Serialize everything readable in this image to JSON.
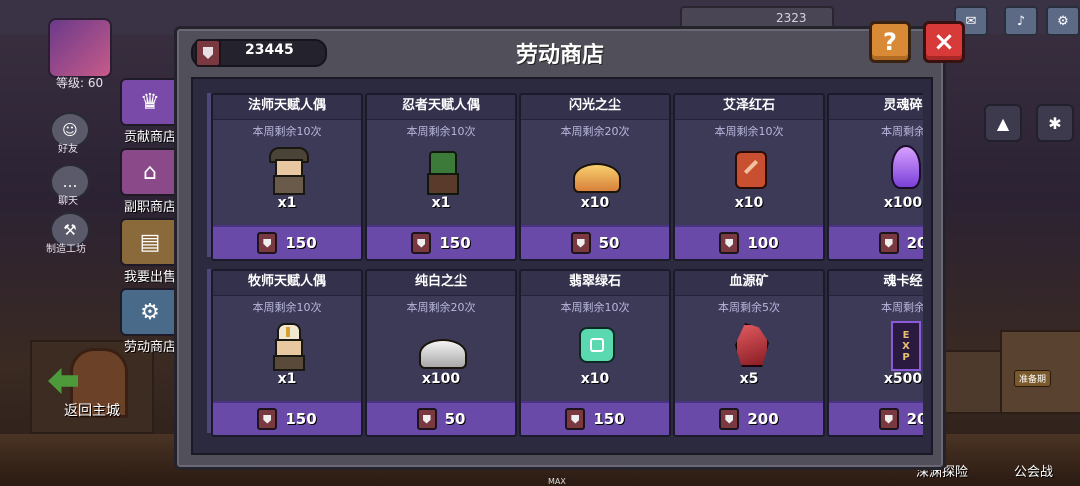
{
  "currency": {
    "amount": "23445"
  },
  "modal": {
    "title": "劳动商店",
    "help_label": "?",
    "close_label": "×"
  },
  "player": {
    "level": "等级: 60"
  },
  "hud": {
    "value": "2323"
  },
  "sidebar": {
    "small": [
      {
        "label": "好友",
        "icon": "friend-icon"
      },
      {
        "label": "聊天",
        "icon": "chat-icon"
      },
      {
        "label": "制造工坊",
        "icon": "workshop-icon"
      }
    ],
    "items": [
      {
        "label": "贡献商店",
        "icon": "contribution-shop-icon",
        "color": "#7a4aa8"
      },
      {
        "label": "副职商店",
        "icon": "side-job-shop-icon",
        "color": "#8a4a8a"
      },
      {
        "label": "我要出售",
        "icon": "sell-icon",
        "color": "#8a6a3a"
      },
      {
        "label": "劳动商店",
        "icon": "labor-shop-icon",
        "color": "#4a6a8a"
      }
    ],
    "back_label": "返回主城"
  },
  "bottom": {
    "left_label": "深渊探险",
    "right_label": "公会战",
    "badge": "准备期",
    "max": "MAX"
  },
  "shop": {
    "row1": [
      {
        "name": "法师天赋人偶",
        "limit": "本周剩余10次",
        "qty": "x1",
        "price": "150",
        "icon": "mage-doll-icon"
      },
      {
        "name": "忍者天赋人偶",
        "limit": "本周剩余10次",
        "qty": "x1",
        "price": "150",
        "icon": "ninja-doll-icon"
      },
      {
        "name": "闪光之尘",
        "limit": "本周剩余20次",
        "qty": "x10",
        "price": "50",
        "icon": "glitter-dust-icon"
      },
      {
        "name": "艾泽红石",
        "limit": "本周剩余10次",
        "qty": "x10",
        "price": "100",
        "icon": "red-stone-icon"
      },
      {
        "name": "灵魂碎",
        "limit": "本周剩余",
        "qty": "x100",
        "price": "20",
        "icon": "soul-shard-icon"
      }
    ],
    "row2": [
      {
        "name": "牧师天赋人偶",
        "limit": "本周剩余10次",
        "qty": "x1",
        "price": "150",
        "icon": "priest-doll-icon"
      },
      {
        "name": "纯白之尘",
        "limit": "本周剩余20次",
        "qty": "x100",
        "price": "50",
        "icon": "white-dust-icon"
      },
      {
        "name": "翡翠绿石",
        "limit": "本周剩余10次",
        "qty": "x10",
        "price": "150",
        "icon": "emerald-icon"
      },
      {
        "name": "血源矿",
        "limit": "本周剩余5次",
        "qty": "x5",
        "price": "200",
        "icon": "blood-ore-icon"
      },
      {
        "name": "魂卡经",
        "limit": "本周剩余",
        "qty": "x500",
        "price": "20",
        "icon": "exp-card-icon"
      }
    ]
  },
  "colors": {
    "price_bar": "#6a4aa8",
    "card_bg": "#3d3a58",
    "close": "#d83a3a",
    "help": "#d98a36"
  }
}
